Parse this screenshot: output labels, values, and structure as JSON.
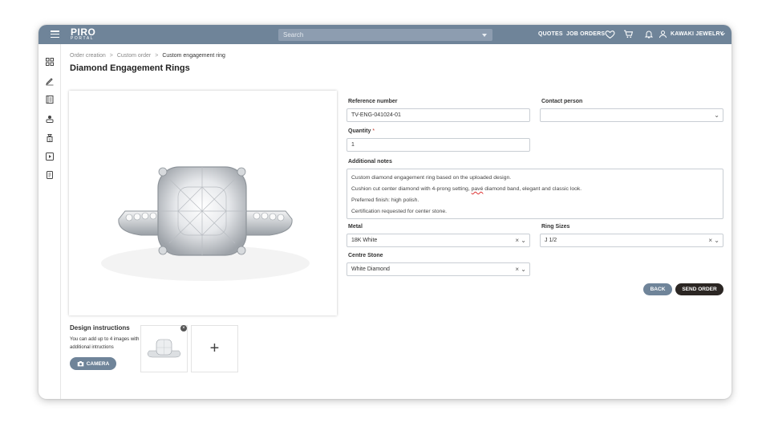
{
  "header": {
    "logo_line1": "PIRO",
    "logo_line2": "PORTAL",
    "search_placeholder": "Search",
    "nav": [
      "QUOTES",
      "JOB ORDERS"
    ],
    "user": "KAWAKI JEWELRY"
  },
  "sidebar": {
    "icons": [
      "dashboard-icon",
      "edit-order-icon",
      "catalog-icon",
      "customers-icon",
      "pricing-icon",
      "media-icon",
      "reports-icon"
    ]
  },
  "breadcrumb": [
    "Order creation",
    "Custom order",
    "Custom engagement ring"
  ],
  "page_title": "Diamond Engagement Rings",
  "design": {
    "title": "Design instructions",
    "text": "You can add up to 4 images with additional intructions",
    "camera_label": "CAMERA"
  },
  "form": {
    "reference_label": "Reference number",
    "reference_value": "TV-ENG-041024-01",
    "contact_label": "Contact person",
    "contact_value": "",
    "quantity_label": "Quantity",
    "quantity_value": "1",
    "notes_label": "Additional notes",
    "notes_lines": [
      "Custom diamond engagement ring based on the uploaded design.",
      "Cushion cut center diamond with 4-prong setting, ",
      "pavé",
      " diamond band, elegant and classic look.",
      "Preferred finish: high polish.",
      "Certification requested for center stone."
    ],
    "metal_label": "Metal",
    "metal_value": "18K White",
    "ring_sizes_label": "Ring Sizes",
    "ring_sizes_value": "J 1/2",
    "centre_stone_label": "Centre Stone",
    "centre_stone_value": "White Diamond"
  },
  "actions": {
    "back": "BACK",
    "send": "SEND ORDER"
  },
  "colors": {
    "accent": "#6f8499",
    "primary_button": "#2b2623"
  }
}
